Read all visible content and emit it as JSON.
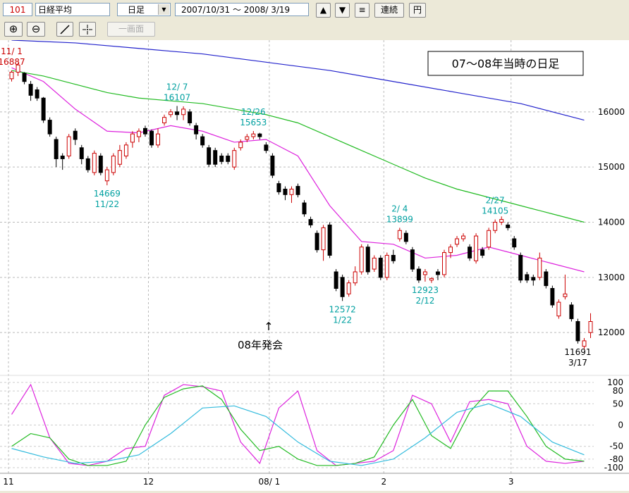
{
  "toolbar": {
    "code": "101",
    "name": "日経平均",
    "period": "日足",
    "date_range": "2007/10/31 ～ 2008/ 3/19",
    "up_arrow": "▲",
    "down_arrow": "▼",
    "menu_glyph": "≡",
    "continuous_label": "連続",
    "yen_label": "円",
    "zoom_in_glyph": "⊕",
    "zoom_out_glyph": "⊖",
    "single_screen_label": "一画面"
  },
  "chart_data": {
    "type": "candlestick",
    "title": "07～08年当時の日足",
    "annotation": {
      "arrow": "↑",
      "text": "08年発会",
      "date": "08/ 1"
    },
    "x_tick_labels": [
      {
        "label": "11",
        "index": 0
      },
      {
        "label": "12",
        "index": 22
      },
      {
        "label": "08/ 1",
        "index": 41
      },
      {
        "label": "2",
        "index": 59
      },
      {
        "label": "3",
        "index": 79
      }
    ],
    "y_axis": {
      "ticks": [
        12000,
        13000,
        14000,
        15000,
        16000
      ],
      "ylim": [
        11300,
        17300
      ]
    },
    "osc_axis": {
      "ticks": [
        100,
        80,
        50,
        0,
        -50,
        -80,
        -100
      ],
      "ylim": [
        -110,
        110
      ]
    },
    "peak_labels": [
      {
        "value": "16887",
        "date": "11/ 1",
        "index": 0,
        "position": "above",
        "color": "#cc0000"
      },
      {
        "value": "14669",
        "date": "11/22",
        "index": 15,
        "position": "below",
        "color": "#00a0a0"
      },
      {
        "value": "16107",
        "date": "12/ 7",
        "index": 26,
        "position": "above",
        "color": "#00a0a0"
      },
      {
        "value": "15653",
        "date": "12/26",
        "index": 38,
        "position": "above",
        "color": "#00a0a0"
      },
      {
        "value": "12572",
        "date": "1/22",
        "index": 52,
        "position": "below",
        "color": "#00a0a0"
      },
      {
        "value": "13899",
        "date": "2/ 4",
        "index": 61,
        "position": "above",
        "color": "#00a0a0"
      },
      {
        "value": "12923",
        "date": "2/12",
        "index": 65,
        "position": "below",
        "color": "#00a0a0"
      },
      {
        "value": "14105",
        "date": "2/27",
        "index": 76,
        "position": "above",
        "color": "#00a0a0"
      },
      {
        "value": "11691",
        "date": "3/17",
        "index": 89,
        "position": "below",
        "color": "#000000"
      }
    ],
    "candles": [
      [
        16600,
        16750,
        16550,
        16720
      ],
      [
        16720,
        16887,
        16650,
        16850
      ],
      [
        16700,
        16720,
        16500,
        16550
      ],
      [
        16500,
        16560,
        16200,
        16300
      ],
      [
        16400,
        16450,
        16200,
        16250
      ],
      [
        16250,
        16270,
        15800,
        15850
      ],
      [
        15850,
        15900,
        15550,
        15600
      ],
      [
        15500,
        15550,
        15000,
        15150
      ],
      [
        15200,
        15250,
        14950,
        15150
      ],
      [
        15200,
        15600,
        15150,
        15550
      ],
      [
        15650,
        15700,
        15400,
        15500
      ],
      [
        15350,
        15400,
        15050,
        15150
      ],
      [
        15150,
        15200,
        14900,
        14950
      ],
      [
        14900,
        15300,
        14850,
        15250
      ],
      [
        15200,
        15250,
        14850,
        14900
      ],
      [
        14750,
        15000,
        14669,
        14950
      ],
      [
        14900,
        15250,
        14850,
        15200
      ],
      [
        15050,
        15400,
        15000,
        15300
      ],
      [
        15200,
        15450,
        15150,
        15400
      ],
      [
        15450,
        15650,
        15350,
        15600
      ],
      [
        15550,
        15700,
        15450,
        15650
      ],
      [
        15700,
        15750,
        15550,
        15600
      ],
      [
        15650,
        15680,
        15350,
        15400
      ],
      [
        15400,
        15700,
        15350,
        15600
      ],
      [
        15800,
        15950,
        15750,
        15900
      ],
      [
        15950,
        16050,
        15900,
        16000
      ],
      [
        16000,
        16107,
        15850,
        15950
      ],
      [
        15950,
        16100,
        15850,
        16050
      ],
      [
        16000,
        16050,
        15750,
        15800
      ],
      [
        15750,
        15800,
        15500,
        15600
      ],
      [
        15550,
        15600,
        15350,
        15400
      ],
      [
        15350,
        15400,
        15000,
        15050
      ],
      [
        15300,
        15350,
        15000,
        15050
      ],
      [
        15200,
        15250,
        15050,
        15100
      ],
      [
        15200,
        15250,
        15050,
        15100
      ],
      [
        15000,
        15350,
        14950,
        15300
      ],
      [
        15350,
        15500,
        15300,
        15450
      ],
      [
        15500,
        15600,
        15450,
        15550
      ],
      [
        15550,
        15653,
        15500,
        15600
      ],
      [
        15600,
        15620,
        15500,
        15550
      ],
      [
        15400,
        15450,
        15250,
        15300
      ],
      [
        15200,
        15250,
        14800,
        14850
      ],
      [
        14700,
        14750,
        14500,
        14550
      ],
      [
        14600,
        14650,
        14400,
        14500
      ],
      [
        14500,
        14650,
        14350,
        14600
      ],
      [
        14650,
        14700,
        14450,
        14500
      ],
      [
        14350,
        14400,
        14100,
        14150
      ],
      [
        14050,
        14100,
        13900,
        13950
      ],
      [
        13800,
        13850,
        13450,
        13500
      ],
      [
        13500,
        13950,
        13300,
        13900
      ],
      [
        13950,
        14000,
        13350,
        13400
      ],
      [
        13100,
        13150,
        12750,
        12800
      ],
      [
        13000,
        13050,
        12572,
        12650
      ],
      [
        12700,
        12950,
        12650,
        12900
      ],
      [
        12900,
        13200,
        12850,
        13100
      ],
      [
        13100,
        13600,
        13050,
        13550
      ],
      [
        13550,
        13600,
        13050,
        13100
      ],
      [
        13150,
        13400,
        13100,
        13350
      ],
      [
        13350,
        13400,
        12950,
        13000
      ],
      [
        13000,
        13450,
        12950,
        13400
      ],
      [
        13400,
        13500,
        13250,
        13300
      ],
      [
        13700,
        13899,
        13650,
        13850
      ],
      [
        13800,
        13850,
        13600,
        13650
      ],
      [
        13500,
        13550,
        13100,
        13150
      ],
      [
        13150,
        13200,
        12900,
        12950
      ],
      [
        13050,
        13150,
        12923,
        13100
      ],
      [
        12950,
        13000,
        12900,
        12980
      ],
      [
        13100,
        13150,
        12950,
        13050
      ],
      [
        13050,
        13500,
        13000,
        13450
      ],
      [
        13450,
        13600,
        13350,
        13550
      ],
      [
        13600,
        13750,
        13550,
        13700
      ],
      [
        13700,
        13800,
        13650,
        13750
      ],
      [
        13550,
        13600,
        13300,
        13350
      ],
      [
        13300,
        13800,
        13250,
        13750
      ],
      [
        13500,
        13550,
        13350,
        13400
      ],
      [
        13550,
        13900,
        13500,
        13850
      ],
      [
        13850,
        14050,
        13800,
        14000
      ],
      [
        14000,
        14105,
        13950,
        14050
      ],
      [
        13950,
        14000,
        13850,
        13900
      ],
      [
        13700,
        13750,
        13500,
        13550
      ],
      [
        13400,
        13450,
        12900,
        12950
      ],
      [
        13050,
        13100,
        12900,
        12950
      ],
      [
        13000,
        13050,
        12850,
        12950
      ],
      [
        13000,
        13450,
        12950,
        13350
      ],
      [
        13100,
        13150,
        12800,
        12850
      ],
      [
        12800,
        12850,
        12450,
        12500
      ],
      [
        12300,
        12600,
        12250,
        12550
      ],
      [
        12650,
        13050,
        12600,
        12700
      ],
      [
        12500,
        12550,
        12200,
        12250
      ],
      [
        12200,
        12250,
        11800,
        11850
      ],
      [
        11750,
        11900,
        11691,
        11850
      ],
      [
        12000,
        12350,
        11900,
        12200
      ]
    ],
    "series": [
      {
        "name": "MA1",
        "color": "#dd22dd",
        "x": [
          0,
          5,
          10,
          15,
          20,
          25,
          30,
          35,
          40,
          45,
          50,
          55,
          60,
          65,
          70,
          75,
          80,
          85,
          90
        ],
        "y": [
          16800,
          16550,
          16050,
          15650,
          15620,
          15750,
          15650,
          15450,
          15500,
          15200,
          14300,
          13650,
          13600,
          13350,
          13400,
          13550,
          13400,
          13250,
          13100
        ]
      },
      {
        "name": "MA2",
        "color": "#22bb22",
        "x": [
          0,
          5,
          10,
          15,
          20,
          25,
          30,
          35,
          40,
          45,
          50,
          55,
          60,
          65,
          70,
          75,
          80,
          85,
          90
        ],
        "y": [
          16750,
          16650,
          16500,
          16350,
          16250,
          16200,
          16150,
          16050,
          15950,
          15800,
          15550,
          15300,
          15050,
          14800,
          14600,
          14450,
          14300,
          14150,
          14000
        ]
      },
      {
        "name": "MA3",
        "color": "#2222cc",
        "x": [
          0,
          10,
          20,
          30,
          40,
          50,
          60,
          70,
          80,
          90
        ],
        "y": [
          17300,
          17250,
          17150,
          17050,
          16900,
          16750,
          16550,
          16350,
          16150,
          15850
        ]
      }
    ],
    "oscillators": [
      {
        "name": "OSC1",
        "color": "#dd22dd",
        "x": [
          0,
          3,
          6,
          9,
          12,
          15,
          18,
          21,
          24,
          27,
          30,
          33,
          36,
          39,
          42,
          45,
          48,
          51,
          54,
          57,
          60,
          63,
          66,
          69,
          72,
          75,
          78,
          81,
          84,
          87,
          90
        ],
        "y": [
          25,
          95,
          -30,
          -90,
          -95,
          -85,
          -55,
          -50,
          70,
          95,
          90,
          80,
          -40,
          -90,
          40,
          80,
          -60,
          -95,
          -90,
          -85,
          -60,
          70,
          50,
          -40,
          55,
          60,
          50,
          -50,
          -85,
          -90,
          -85
        ]
      },
      {
        "name": "OSC2",
        "color": "#22bb22",
        "x": [
          0,
          3,
          6,
          9,
          12,
          15,
          18,
          21,
          24,
          27,
          30,
          33,
          36,
          39,
          42,
          45,
          48,
          51,
          54,
          57,
          60,
          63,
          66,
          69,
          72,
          75,
          78,
          81,
          84,
          87,
          90
        ],
        "y": [
          -50,
          -20,
          -30,
          -80,
          -95,
          -95,
          -85,
          0,
          65,
          85,
          92,
          60,
          -10,
          -60,
          -50,
          -80,
          -95,
          -95,
          -90,
          -75,
          0,
          60,
          -25,
          -55,
          30,
          80,
          80,
          20,
          -50,
          -80,
          -85
        ]
      },
      {
        "name": "OSC3",
        "color": "#33bbdd",
        "x": [
          0,
          5,
          10,
          15,
          20,
          25,
          30,
          35,
          40,
          45,
          50,
          55,
          60,
          65,
          70,
          75,
          80,
          85,
          90
        ],
        "y": [
          -55,
          -75,
          -90,
          -85,
          -70,
          -20,
          40,
          45,
          20,
          -40,
          -85,
          -95,
          -80,
          -30,
          30,
          50,
          20,
          -40,
          -70
        ]
      }
    ]
  }
}
